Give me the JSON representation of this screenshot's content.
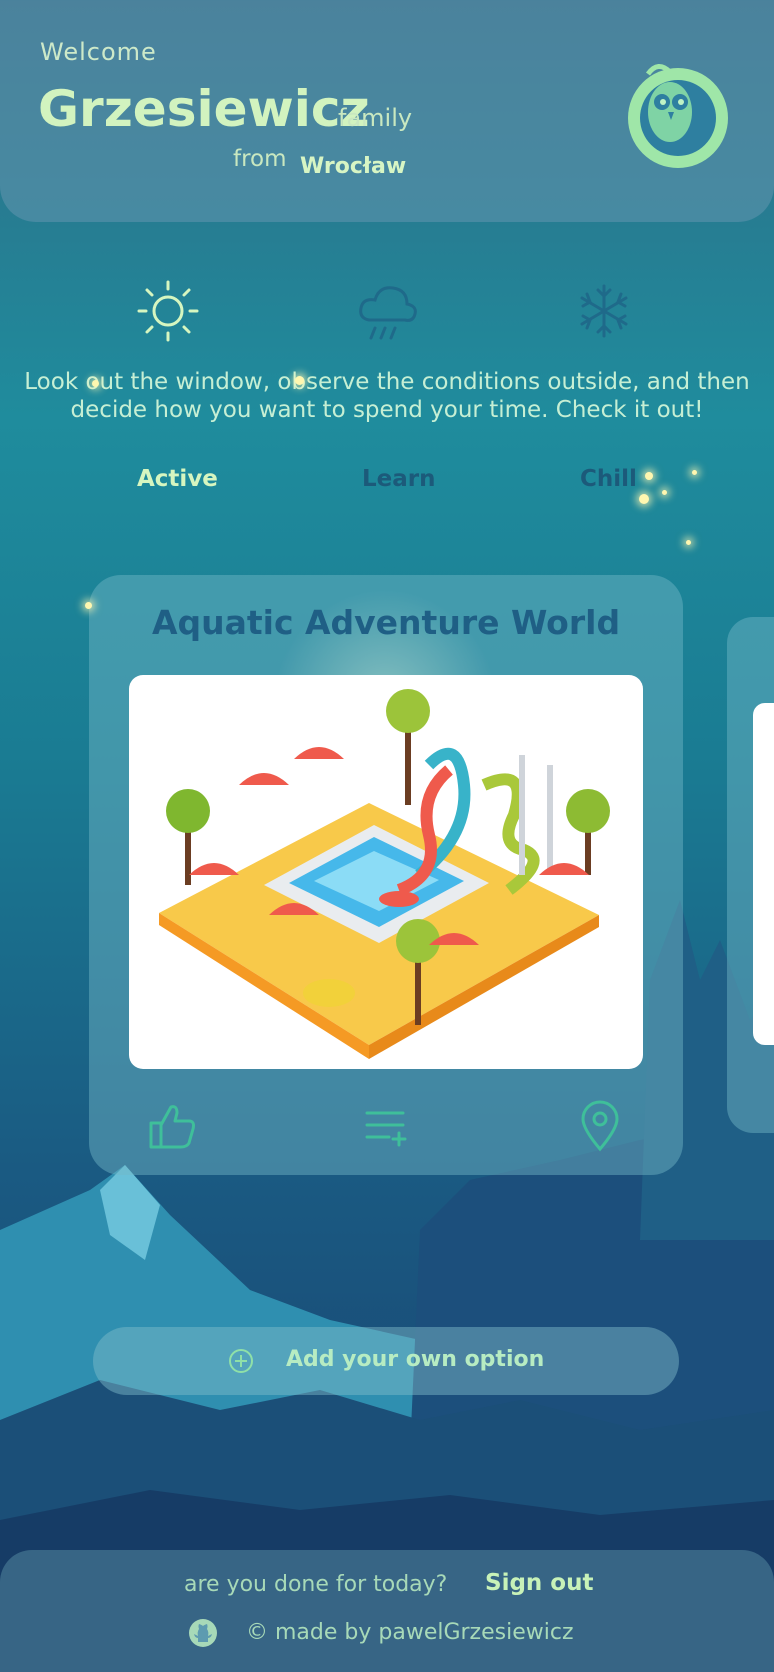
{
  "header": {
    "welcome": "Welcome",
    "surname": "Grzesiewicz",
    "family_word": "family",
    "from_word": "from",
    "city": "Wrocław",
    "avatar_icon": "owl-mascot-icon"
  },
  "weather": {
    "icons": [
      "sun-icon",
      "rain-cloud-icon",
      "snowflake-icon"
    ],
    "description": "Look out the window, observe the conditions outside, and then decide how you want to spend your time. Check it out!"
  },
  "tabs": [
    {
      "label": "Active",
      "active": true
    },
    {
      "label": "Learn",
      "active": false
    },
    {
      "label": "Chill",
      "active": false
    }
  ],
  "card": {
    "title": "Aquatic Adventure World",
    "image": "water-park-illustration",
    "actions": [
      "thumbs-up-icon",
      "add-to-list-icon",
      "location-pin-icon"
    ]
  },
  "add_option": {
    "label": "Add your own option",
    "icon": "plus-circle-icon"
  },
  "footer": {
    "question": "are you done for today?",
    "sign_out": "Sign out",
    "made_by": "© made by pawelGrzesiewicz",
    "github_icon": "github-icon"
  },
  "colors": {
    "accent_light_green": "#d2f3bf",
    "text_dark_blue": "#1f5f85",
    "icon_green": "#7fd3a5"
  }
}
